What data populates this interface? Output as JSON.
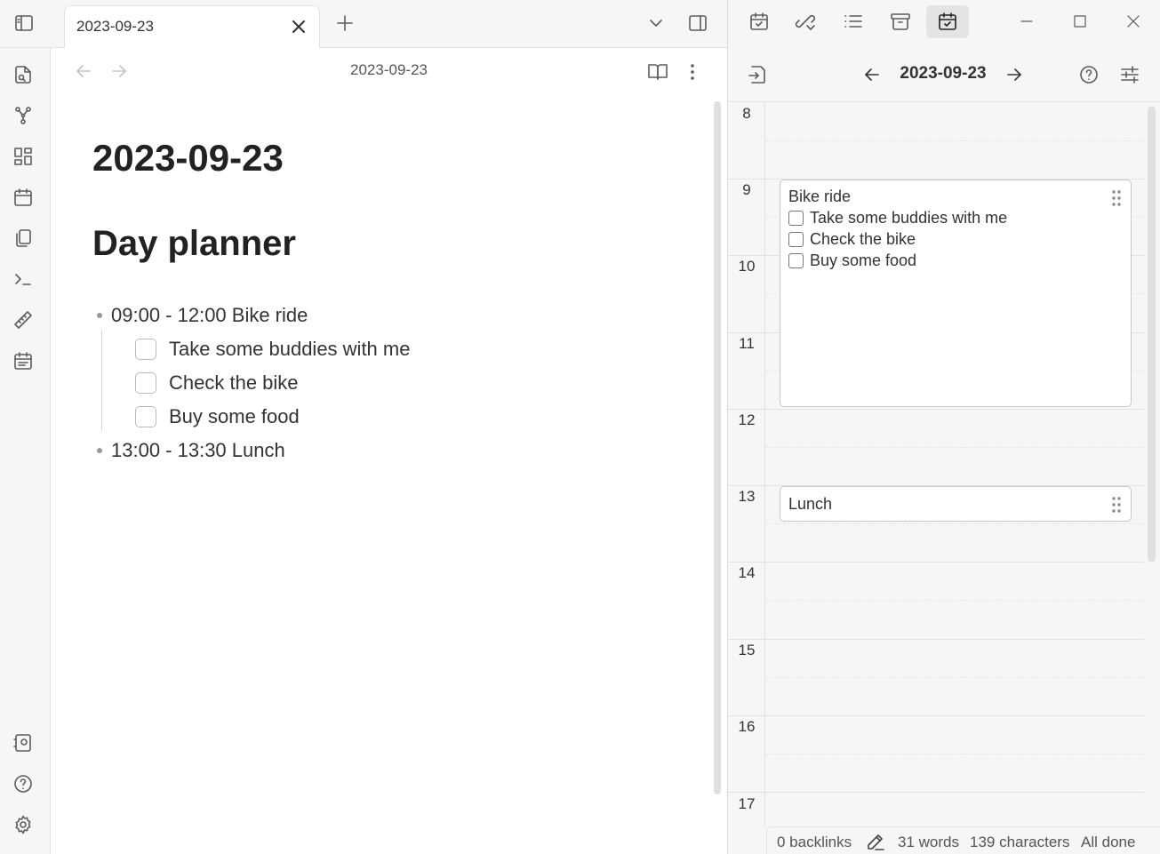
{
  "tab": {
    "title": "2023-09-23"
  },
  "editor": {
    "nav_title": "2023-09-23",
    "title": "2023-09-23",
    "heading": "Day planner",
    "items": [
      {
        "text": "09:00 - 12:00 Bike ride"
      },
      {
        "text": "13:00 - 13:30 Lunch"
      }
    ],
    "tasks": [
      {
        "text": "Take some buddies with me",
        "checked": false
      },
      {
        "text": "Check the bike",
        "checked": false
      },
      {
        "text": "Buy some food",
        "checked": false
      }
    ]
  },
  "planner": {
    "date": "2023-09-23",
    "hours": [
      "8",
      "9",
      "10",
      "11",
      "12",
      "13",
      "14",
      "15",
      "16",
      "17"
    ],
    "events": [
      {
        "title": "Bike ride",
        "tasks": [
          "Take some buddies with me",
          "Check the bike",
          "Buy some food"
        ]
      },
      {
        "title": "Lunch",
        "tasks": []
      }
    ]
  },
  "status": {
    "backlinks": "0 backlinks",
    "words": "31 words",
    "characters": "139 characters",
    "sync": "All done"
  },
  "icons": {
    "ribbon_top": [
      "open-quick-switcher-icon",
      "graph-view-icon",
      "canvas-icon",
      "daily-note-icon",
      "templates-icon",
      "command-palette-icon",
      "ruler-icon",
      "day-planner-icon"
    ],
    "ribbon_bottom": [
      "vault-icon",
      "help-icon",
      "settings-icon"
    ]
  },
  "colors": {
    "accent": "#7b6cd9",
    "background": "#ffffff",
    "panel": "#f6f6f6"
  }
}
